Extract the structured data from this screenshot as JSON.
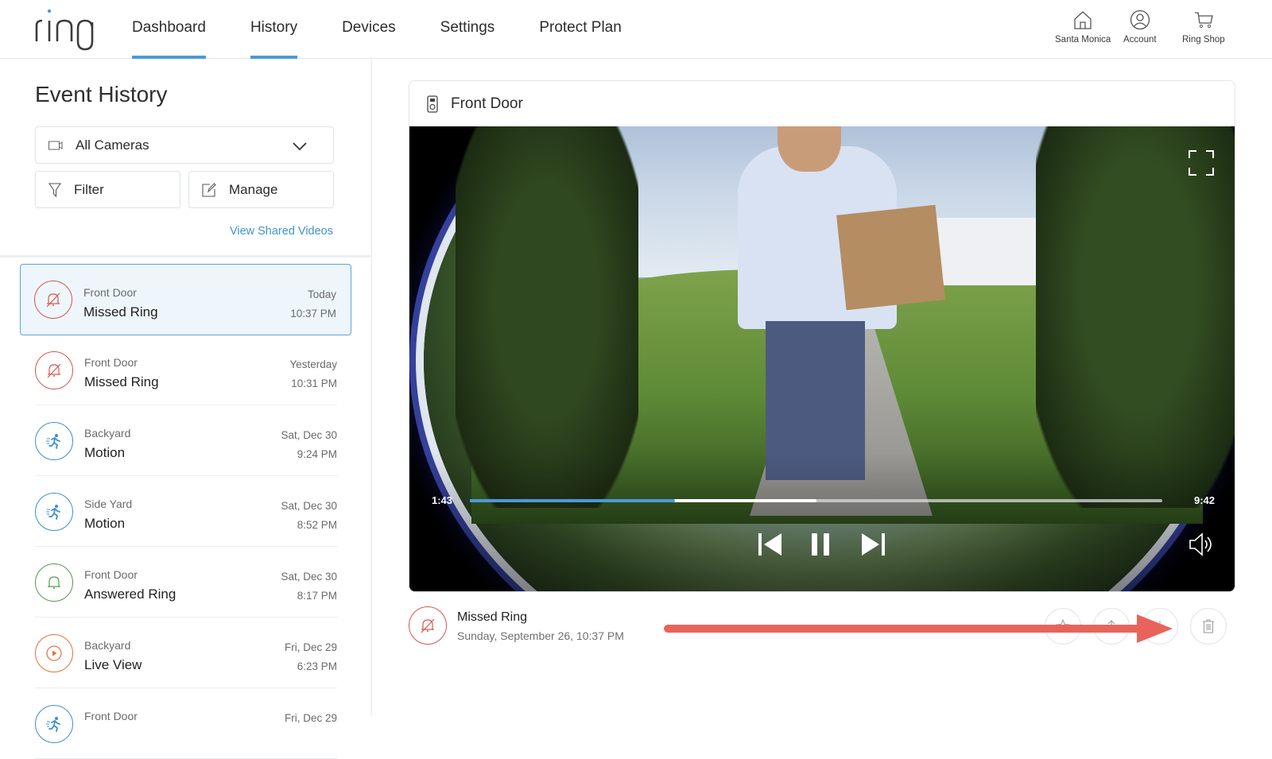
{
  "brand": {
    "logo_text": "ring",
    "accent": "#4b9ad6"
  },
  "nav": {
    "items": [
      {
        "label": "Dashboard",
        "active": true
      },
      {
        "label": "History",
        "active": true
      },
      {
        "label": "Devices",
        "active": false
      },
      {
        "label": "Settings",
        "active": false
      },
      {
        "label": "Protect Plan",
        "active": false
      }
    ],
    "utilities": [
      {
        "label": "Santa Monica",
        "icon": "home-icon"
      },
      {
        "label": "Account",
        "icon": "account-icon"
      },
      {
        "label": "Ring Shop",
        "icon": "cart-icon"
      }
    ]
  },
  "sidebar": {
    "title": "Event History",
    "camera_select": {
      "value": "All Cameras",
      "icon": "camera-icon"
    },
    "filter_label": "Filter",
    "manage_label": "Manage",
    "shared_link": "View Shared Videos",
    "events": [
      {
        "camera": "Front Door",
        "type": "Missed Ring",
        "date": "Today",
        "time": "10:37 PM",
        "kind": "missed",
        "color": "#d7564b",
        "selected": true
      },
      {
        "camera": "Front Door",
        "type": "Missed Ring",
        "date": "Yesterday",
        "time": "10:31 PM",
        "kind": "missed",
        "color": "#d7564b",
        "selected": false
      },
      {
        "camera": "Backyard",
        "type": "Motion",
        "date": "Sat, Dec 30",
        "time": "9:24 PM",
        "kind": "motion",
        "color": "#3b8fd0",
        "selected": false
      },
      {
        "camera": "Side Yard",
        "type": "Motion",
        "date": "Sat, Dec 30",
        "time": "8:52 PM",
        "kind": "motion",
        "color": "#3b8fd0",
        "selected": false
      },
      {
        "camera": "Front Door",
        "type": "Answered Ring",
        "date": "Sat, Dec 30",
        "time": "8:17 PM",
        "kind": "answered",
        "color": "#4e9e4a",
        "selected": false
      },
      {
        "camera": "Backyard",
        "type": "Live View",
        "date": "Fri, Dec 29",
        "time": "6:23 PM",
        "kind": "live",
        "color": "#e0733a",
        "selected": false
      },
      {
        "camera": "Front Door",
        "type": "",
        "date": "Fri, Dec 29",
        "time": "",
        "kind": "motion",
        "color": "#3b8fd0",
        "selected": false
      }
    ]
  },
  "player": {
    "device_name": "Front Door",
    "current_time": "1:43",
    "duration": "9:42",
    "progress_fraction": 0.296,
    "buffered_fraction": 0.501
  },
  "event_detail": {
    "title": "Missed Ring",
    "datetime": "Sunday,  September 26, 10:37 PM",
    "actions": [
      "star-icon",
      "share-icon",
      "download-icon",
      "trash-icon"
    ],
    "annotation_color": "#e8645a"
  }
}
